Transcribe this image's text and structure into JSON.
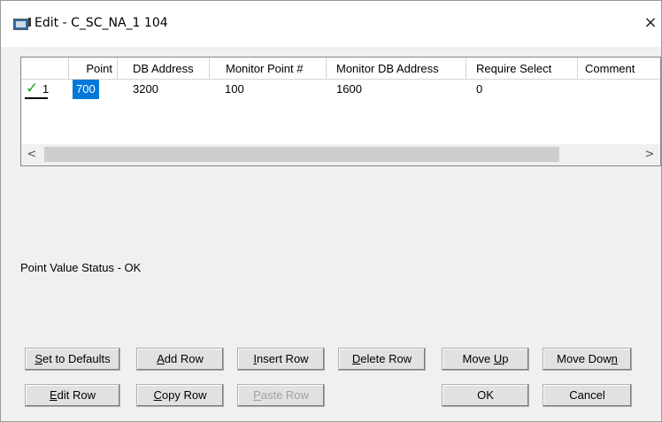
{
  "window": {
    "title": "Edit - C_SC_NA_1 104",
    "close_glyph": "×"
  },
  "grid": {
    "columns": [
      "",
      "Point",
      "DB Address",
      "Monitor Point #",
      "Monitor DB Address",
      "Require Select",
      "Comment"
    ],
    "rows": [
      {
        "row_number": "1",
        "checked": true,
        "point": "700",
        "db_address": "3200",
        "monitor_point": "100",
        "monitor_db_address": "1600",
        "require_select": "0",
        "comment": ""
      }
    ],
    "scroll_left": "<",
    "scroll_right": ">"
  },
  "status": {
    "text": "Point Value Status - OK"
  },
  "buttons": {
    "set_to_defaults": {
      "pre": "",
      "acc": "S",
      "post": "et to Defaults"
    },
    "add_row": {
      "pre": "",
      "acc": "A",
      "post": "dd Row"
    },
    "insert_row": {
      "pre": "",
      "acc": "I",
      "post": "nsert Row"
    },
    "delete_row": {
      "pre": "",
      "acc": "D",
      "post": "elete Row"
    },
    "move_up": {
      "pre": "Move ",
      "acc": "U",
      "post": "p"
    },
    "move_down": {
      "pre": "Move Dow",
      "acc": "n",
      "post": ""
    },
    "edit_row": {
      "pre": "",
      "acc": "E",
      "post": "dit Row"
    },
    "copy_row": {
      "pre": "",
      "acc": "C",
      "post": "opy Row"
    },
    "paste_row": {
      "pre": "",
      "acc": "P",
      "post": "aste Row"
    },
    "ok": {
      "pre": "OK",
      "acc": "",
      "post": ""
    },
    "cancel": {
      "pre": "Cancel",
      "acc": "",
      "post": ""
    }
  },
  "colors": {
    "selection": "#0078d7",
    "check": "#1fa01f"
  }
}
